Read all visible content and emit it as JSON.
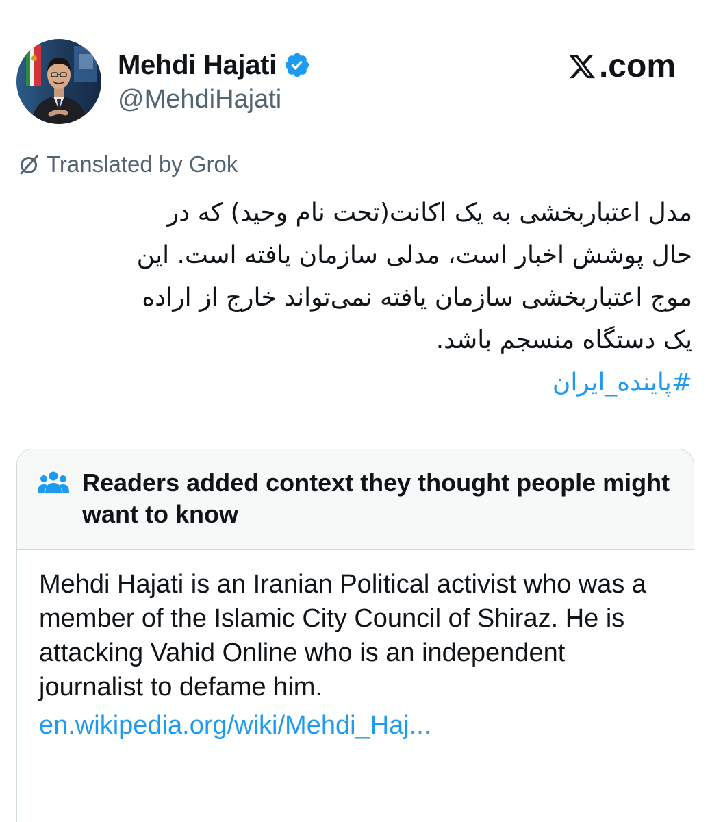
{
  "author": {
    "display_name": "Mehdi Hajati",
    "handle": "@MehdiHajati",
    "verified": true,
    "verified_icon": "verified-badge-icon",
    "avatar_icon": "avatar-photo"
  },
  "site": {
    "logo_text": ".com",
    "logo_icon": "x-logo-icon"
  },
  "translation": {
    "label": "Translated by Grok",
    "icon": "translate-icon"
  },
  "tweet": {
    "lines": [
      "مدل اعتباربخشی به یک اکانت(تحت نام وحید) که در",
      "حال پوشش اخبار است، مدلی سازمان یافته است. این",
      "موج اعتباربخشی سازمان یافته نمی‌تواند خارج از اراده",
      "یک دستگاه منسجم باشد."
    ],
    "hashtag": "#پاینده_ایران"
  },
  "community_note": {
    "header": "Readers added context they thought people might want to know",
    "header_icon": "people-icon",
    "body": "Mehdi Hajati is an Iranian Political activist who was a member of the Islamic City Council of Shiraz. He is attacking Vahid Online who is an independent journalist to defame him.",
    "link": "en.wikipedia.org/wiki/Mehdi_Haj..."
  },
  "colors": {
    "text_primary": "#0f1419",
    "text_secondary": "#536471",
    "link_blue": "#1d9bf0",
    "border": "#cfd9de",
    "note_header_bg": "#f7f9f9"
  }
}
